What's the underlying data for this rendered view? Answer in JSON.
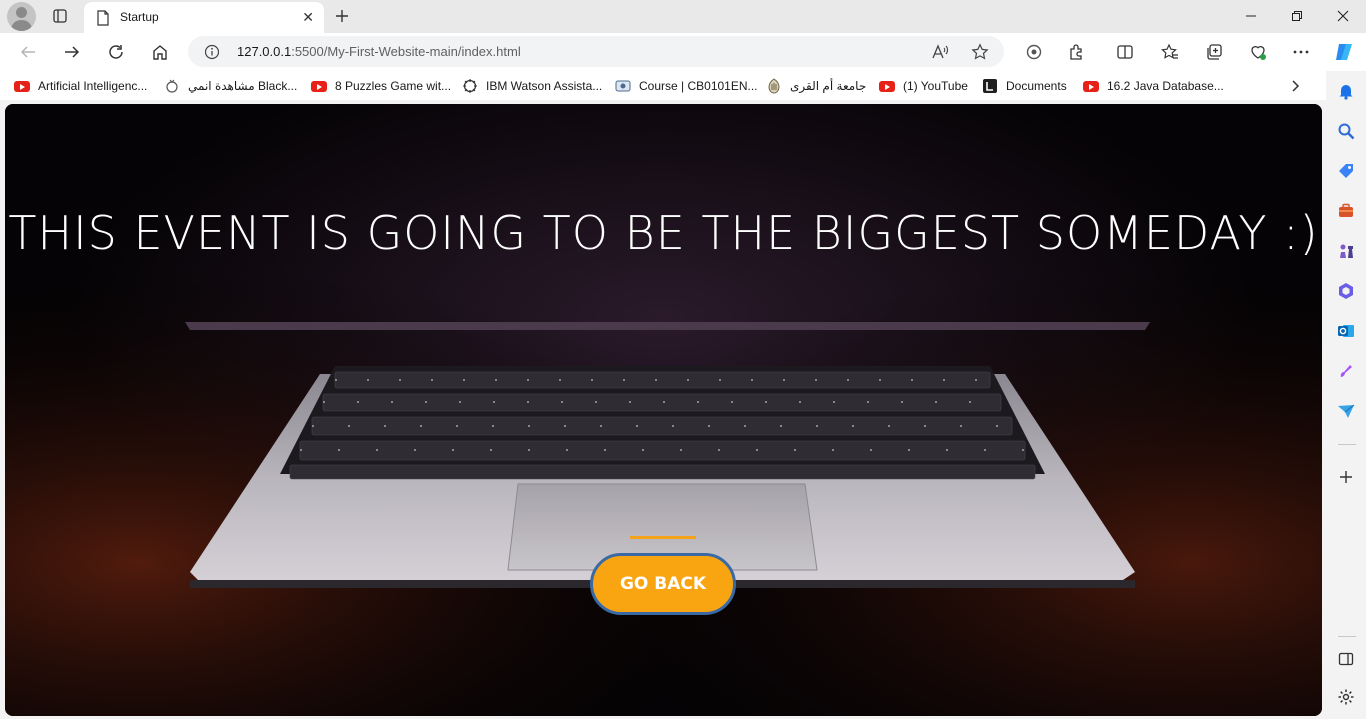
{
  "browser": {
    "tab": {
      "title": "Startup"
    },
    "address": {
      "host": "127.0.0.1",
      "rest": ":5500/My-First-Website-main/index.html"
    },
    "bookmarks": [
      {
        "icon": "youtube-icon",
        "label": "Artificial Intelligenc..."
      },
      {
        "icon": "tv-icon",
        "label": "مشاهدة انمي Black..."
      },
      {
        "icon": "youtube-icon",
        "label": "8 Puzzles Game wit..."
      },
      {
        "icon": "ibm-icon",
        "label": "IBM Watson Assista..."
      },
      {
        "icon": "course-icon",
        "label": "Course | CB0101EN..."
      },
      {
        "icon": "university-icon",
        "label": "جامعة أم القرى"
      },
      {
        "icon": "youtube-icon",
        "label": "(1) YouTube"
      },
      {
        "icon": "documents-icon",
        "label": "Documents"
      },
      {
        "icon": "youtube-icon",
        "label": "16.2 Java Database..."
      }
    ]
  },
  "page": {
    "headline": "THIS EVENT IS GOING TO BE THE BIGGEST SOMEDAY :)",
    "button_label": "GO BACK",
    "accent": "#f9a511",
    "button_border": "#3a6aa5"
  }
}
